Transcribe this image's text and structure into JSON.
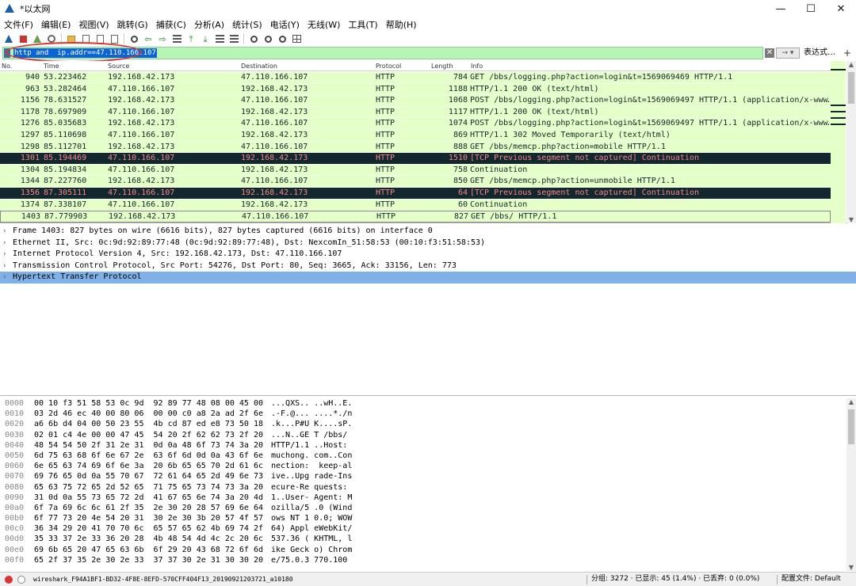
{
  "window": {
    "title": "*以太网",
    "controls": {
      "minimize": "—",
      "maximize": "☐",
      "close": "✕"
    }
  },
  "menu": [
    "文件(F)",
    "编辑(E)",
    "视图(V)",
    "跳转(G)",
    "捕获(C)",
    "分析(A)",
    "统计(S)",
    "电话(Y)",
    "无线(W)",
    "工具(T)",
    "帮助(H)"
  ],
  "toolbar_icons": [
    "start-capture-icon",
    "stop-capture-icon",
    "restart-capture-icon",
    "capture-options-icon",
    "open-file-icon",
    "save-file-icon",
    "close-file-icon",
    "reload-icon",
    "find-packet-icon",
    "go-back-icon",
    "go-forward-icon",
    "go-to-packet-icon",
    "go-first-icon",
    "go-last-icon",
    "autoscroll-icon",
    "colorize-icon",
    "zoom-in-icon",
    "zoom-out-icon",
    "zoom-normal-icon",
    "resize-columns-icon"
  ],
  "filter": {
    "value": "http and  ip.addr==47.110.166.107",
    "expression_label": "表达式…",
    "add_label": "+",
    "highlight_color": "#e0312b"
  },
  "packet_list": {
    "columns": [
      "No.",
      "Time",
      "Source",
      "Destination",
      "Protocol",
      "Length",
      "Info"
    ],
    "rows": [
      {
        "no": "940",
        "time": "53.223462",
        "src": "192.168.42.173",
        "dst": "47.110.166.107",
        "proto": "HTTP",
        "len": "784",
        "info": "GET /bbs/logging.php?action=login&t=1569069469 HTTP/1.1"
      },
      {
        "no": "963",
        "time": "53.282464",
        "src": "47.110.166.107",
        "dst": "192.168.42.173",
        "proto": "HTTP",
        "len": "1188",
        "info": "HTTP/1.1 200 OK  (text/html)"
      },
      {
        "no": "1156",
        "time": "78.631527",
        "src": "192.168.42.173",
        "dst": "47.110.166.107",
        "proto": "HTTP",
        "len": "1068",
        "info": "POST /bbs/logging.php?action=login&t=1569069497 HTTP/1.1  (application/x-www…"
      },
      {
        "no": "1178",
        "time": "78.697909",
        "src": "47.110.166.107",
        "dst": "192.168.42.173",
        "proto": "HTTP",
        "len": "1117",
        "info": "HTTP/1.1 200 OK  (text/html)"
      },
      {
        "no": "1276",
        "time": "85.035683",
        "src": "192.168.42.173",
        "dst": "47.110.166.107",
        "proto": "HTTP",
        "len": "1074",
        "info": "POST /bbs/logging.php?action=login&t=1569069497 HTTP/1.1  (application/x-www…"
      },
      {
        "no": "1297",
        "time": "85.110698",
        "src": "47.110.166.107",
        "dst": "192.168.42.173",
        "proto": "HTTP",
        "len": "869",
        "info": "HTTP/1.1 302 Moved Temporarily  (text/html)"
      },
      {
        "no": "1298",
        "time": "85.112701",
        "src": "192.168.42.173",
        "dst": "47.110.166.107",
        "proto": "HTTP",
        "len": "888",
        "info": "GET /bbs/memcp.php?action=mobile HTTP/1.1"
      },
      {
        "no": "1301",
        "time": "85.194469",
        "src": "47.110.166.107",
        "dst": "192.168.42.173",
        "proto": "HTTP",
        "len": "1510",
        "info": "[TCP Previous segment not captured] Continuation",
        "bad": true
      },
      {
        "no": "1304",
        "time": "85.194834",
        "src": "47.110.166.107",
        "dst": "192.168.42.173",
        "proto": "HTTP",
        "len": "758",
        "info": "Continuation"
      },
      {
        "no": "1344",
        "time": "87.227760",
        "src": "192.168.42.173",
        "dst": "47.110.166.107",
        "proto": "HTTP",
        "len": "850",
        "info": "GET /bbs/memcp.php?action=unmobile HTTP/1.1"
      },
      {
        "no": "1356",
        "time": "87.305111",
        "src": "47.110.166.107",
        "dst": "192.168.42.173",
        "proto": "HTTP",
        "len": "64",
        "info": "[TCP Previous segment not captured] Continuation",
        "bad": true
      },
      {
        "no": "1374",
        "time": "87.338107",
        "src": "47.110.166.107",
        "dst": "192.168.42.173",
        "proto": "HTTP",
        "len": "60",
        "info": "Continuation"
      },
      {
        "no": "1403",
        "time": "87.779903",
        "src": "192.168.42.173",
        "dst": "47.110.166.107",
        "proto": "HTTP",
        "len": "827",
        "info": "GET /bbs/ HTTP/1.1",
        "selected": true
      }
    ]
  },
  "details": [
    "Frame 1403: 827 bytes on wire (6616 bits), 827 bytes captured (6616 bits) on interface 0",
    "Ethernet II, Src: 0c:9d:92:89:77:48 (0c:9d:92:89:77:48), Dst: NexcomIn_51:58:53 (00:10:f3:51:58:53)",
    "Internet Protocol Version 4, Src: 192.168.42.173, Dst: 47.110.166.107",
    "Transmission Control Protocol, Src Port: 54276, Dst Port: 80, Seq: 3665, Ack: 33156, Len: 773",
    "Hypertext Transfer Protocol"
  ],
  "bytes": [
    {
      "off": "0000",
      "hex": "00 10 f3 51 58 53 0c 9d  92 89 77 48 08 00 45 00",
      "ascii": "...QXS.. ..wH..E."
    },
    {
      "off": "0010",
      "hex": "03 2d 46 ec 40 00 80 06  00 00 c0 a8 2a ad 2f 6e",
      "ascii": ".-F.@... ....*./n"
    },
    {
      "off": "0020",
      "hex": "a6 6b d4 04 00 50 23 55  4b cd 87 ed e8 73 50 18",
      "ascii": ".k...P#U K....sP."
    },
    {
      "off": "0030",
      "hex": "02 01 c4 4e 00 00 47 45  54 20 2f 62 62 73 2f 20",
      "ascii": "...N..GE T /bbs/"
    },
    {
      "off": "0040",
      "hex": "48 54 54 50 2f 31 2e 31  0d 0a 48 6f 73 74 3a 20",
      "ascii": "HTTP/1.1 ..Host:"
    },
    {
      "off": "0050",
      "hex": "6d 75 63 68 6f 6e 67 2e  63 6f 6d 0d 0a 43 6f 6e",
      "ascii": "muchong. com..Con"
    },
    {
      "off": "0060",
      "hex": "6e 65 63 74 69 6f 6e 3a  20 6b 65 65 70 2d 61 6c",
      "ascii": "nection:  keep-al"
    },
    {
      "off": "0070",
      "hex": "69 76 65 0d 0a 55 70 67  72 61 64 65 2d 49 6e 73",
      "ascii": "ive..Upg rade-Ins"
    },
    {
      "off": "0080",
      "hex": "65 63 75 72 65 2d 52 65  71 75 65 73 74 73 3a 20",
      "ascii": "ecure-Re quests:"
    },
    {
      "off": "0090",
      "hex": "31 0d 0a 55 73 65 72 2d  41 67 65 6e 74 3a 20 4d",
      "ascii": "1..User- Agent: M"
    },
    {
      "off": "00a0",
      "hex": "6f 7a 69 6c 6c 61 2f 35  2e 30 20 28 57 69 6e 64",
      "ascii": "ozilla/5 .0 (Wind"
    },
    {
      "off": "00b0",
      "hex": "6f 77 73 20 4e 54 20 31  30 2e 30 3b 20 57 4f 57",
      "ascii": "ows NT 1 0.0; WOW"
    },
    {
      "off": "00c0",
      "hex": "36 34 29 20 41 70 70 6c  65 57 65 62 4b 69 74 2f",
      "ascii": "64) Appl eWebKit/"
    },
    {
      "off": "00d0",
      "hex": "35 33 37 2e 33 36 20 28  4b 48 54 4d 4c 2c 20 6c",
      "ascii": "537.36 ( KHTML, l"
    },
    {
      "off": "00e0",
      "hex": "69 6b 65 20 47 65 63 6b  6f 29 20 43 68 72 6f 6d",
      "ascii": "ike Geck o) Chrom"
    },
    {
      "off": "00f0",
      "hex": "65 2f 37 35 2e 30 2e 33  37 37 30 2e 31 30 30 20",
      "ascii": "e/75.0.3 770.100"
    }
  ],
  "status": {
    "file": "wireshark_F94A1BF1-BD32-4F8E-8EFD-570CFF404F13_20190921203721_a10180",
    "stats": "分组: 3272 · 已显示: 45 (1.4%) · 已丢弃: 0 (0.0%)",
    "profile": "配置文件: Default"
  }
}
